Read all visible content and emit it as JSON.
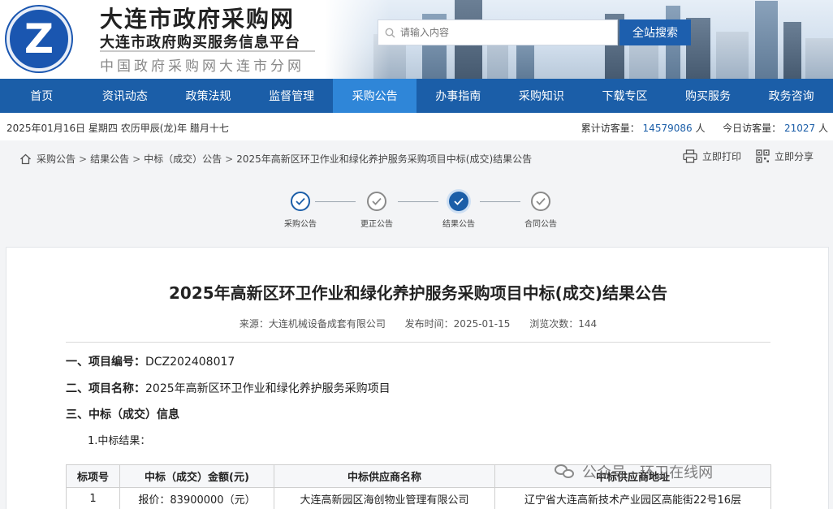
{
  "header": {
    "title": "大连市政府采购网",
    "subtitle": "大连市政府购买服务信息平台",
    "branch": "中国政府采购网大连市分网",
    "search_placeholder": "请输入内容",
    "search_button": "全站搜索"
  },
  "nav": {
    "items": [
      "首页",
      "资讯动态",
      "政策法规",
      "监督管理",
      "采购公告",
      "办事指南",
      "采购知识",
      "下载专区",
      "购买服务",
      "政务咨询"
    ],
    "active": "采购公告"
  },
  "infobar": {
    "date": "2025年01月16日 星期四 农历甲辰(龙)年 腊月十七",
    "total_label": "累计访客量：",
    "total_value": "14579086",
    "total_unit": "人",
    "today_label": "今日访客量：",
    "today_value": "21027",
    "today_unit": "人"
  },
  "breadcrumb": {
    "items": [
      "采购公告",
      "结果公告",
      "中标（成交）公告",
      "2025年高新区环卫作业和绿化养护服务采购项目中标(成交)结果公告"
    ],
    "separator": ">"
  },
  "actions": {
    "print": "立即打印",
    "share": "立即分享"
  },
  "steps": {
    "items": [
      "采购公告",
      "更正公告",
      "结果公告",
      "合同公告"
    ],
    "active": "结果公告"
  },
  "article": {
    "title": "2025年高新区环卫作业和绿化养护服务采购项目中标(成交)结果公告",
    "source": "来源：大连机械设备成套有限公司",
    "publish": "发布时间：2025-01-15",
    "views": "浏览次数：144",
    "sec1_label": "一、项目编号：",
    "sec1_value": "DCZ202408017",
    "sec2_label": "二、项目名称：",
    "sec2_value": "2025年高新区环卫作业和绿化养护服务采购项目",
    "sec3_label": "三、中标（成交）信息",
    "sub1": "1.中标结果：",
    "table": {
      "headers": [
        "标项号",
        "中标（成交）金额(元)",
        "中标供应商名称",
        "中标供应商地址"
      ],
      "rows": [
        [
          "1",
          "报价：83900000（元）",
          "大连高新园区海创物业管理有限公司",
          "辽宁省大连高新技术产业园区高能街22号16层"
        ]
      ]
    }
  },
  "watermark": "公众号 · 环卫在线网",
  "colors": {
    "nav": "#1b5ea8",
    "nav_active": "#2f86d8",
    "accent": "#1b5ea8"
  }
}
